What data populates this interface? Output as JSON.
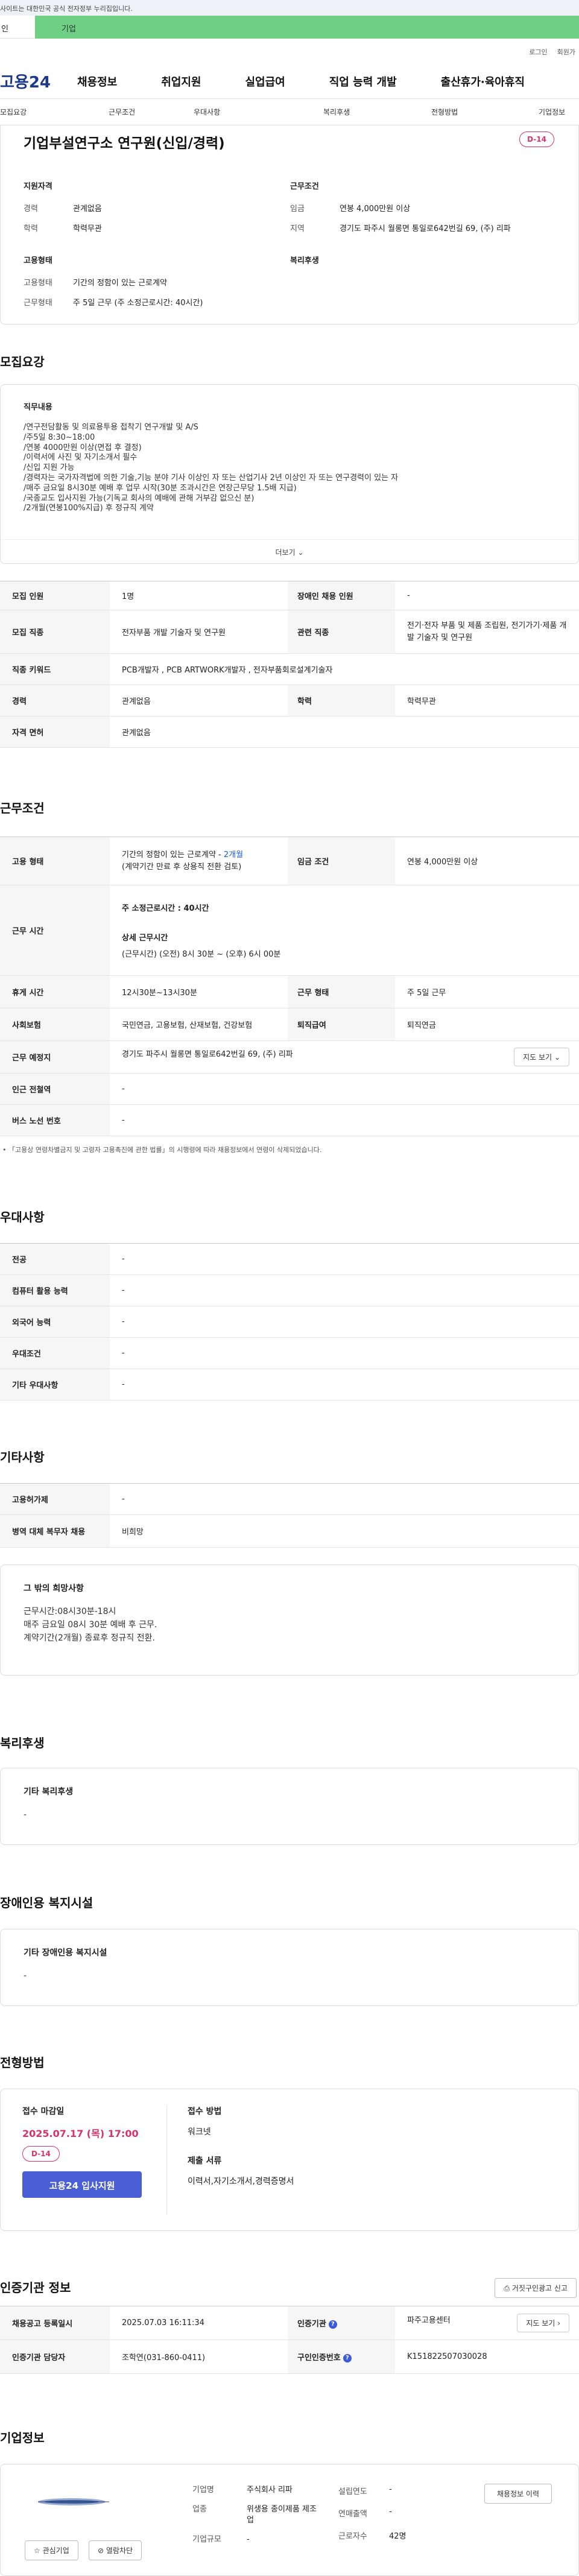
{
  "gov_banner": "사이트는 대한민국 공식 전자정부 누리집입니다.",
  "site_tabs": [
    "인",
    "기업"
  ],
  "util": {
    "login": "로그인",
    "join": "회원가"
  },
  "gnb": {
    "logo": "고용24",
    "items": [
      "채용정보",
      "취업지원",
      "실업급여",
      "직업 능력 개발",
      "출산휴가·육아휴직"
    ]
  },
  "subnav": [
    "모집요강",
    "근무조건",
    "우대사항",
    "복리후생",
    "전형방법",
    "기업정보"
  ],
  "summary": {
    "title": "기업부설연구소 연구원(신입/경력)",
    "dday": "D-14",
    "qual_heading": "지원자격",
    "career_key": "경력",
    "career_val": "관계없음",
    "edu_key": "학력",
    "edu_val": "학력무관",
    "cond_heading": "근무조건",
    "wage_key": "임금",
    "wage_val": "연봉 4,000만원 이상",
    "area_key": "지역",
    "area_val": "경기도 파주시 월롱면 통일로642번길 69, (주) 리파",
    "emp_heading": "고용형태",
    "emp_type_key": "고용형태",
    "emp_type_val": "기간의 정함이 있는 근로계약",
    "work_key": "근무형태",
    "work_val": "주 5일 근무 (주 소정근로시간: 40시간)",
    "welfare_heading": "복리후생"
  },
  "recruit": {
    "heading": "모집요강",
    "duty_heading": "직무내용",
    "duty_lines": [
      "/연구전담활동 및 의료용투용 접착기 연구개발 및 A/S",
      "/주5일 8:30~18:00",
      "/연봉 4000만원 이상(면접 후 결정)",
      "/이력서에 사진 및 자기소개서 필수",
      "/신입 지원 가능",
      "/경력자는 국가자격법에 의한 기술,기능 분야 기사 이상인 자 또는 산업기사 2년 이상인 자 또는 연구경력이 있는 자",
      "/매주 금요일 8시30분 예배 후 업무 시작(30분 조과시간은 연장근무당 1.5배 지급)",
      "/국종교도 입사지원 가능(기독교 회사의 예배에 관해 거부감 없으신 분)",
      "/2개월(연봉100%지급) 후 정규직 계약"
    ],
    "more": "더보기",
    "table": {
      "count_label": "모집 인원",
      "count_val": "1명",
      "disabled_label": "장애인 채용 인원",
      "disabled_val": "-",
      "job_label": "모집 직종",
      "job_val": "전자부품 개발 기술자 및 연구원",
      "rel_job_label": "관련 직종",
      "rel_job_val": "전기·전자 부품 및 제품 조립원, 전기가기·제품 개발 기술자 및 연구원",
      "keyword_label": "직종 키워드",
      "keyword_val": "PCB개발자 , PCB ARTWORK개발자 , 전자부품회로설계기술자",
      "career_label": "경력",
      "career_val": "관계없음",
      "edu_label": "학력",
      "edu_val": "학력무관",
      "license_label": "자격 면허",
      "license_val": "관계없음"
    }
  },
  "conditions": {
    "heading": "근무조건",
    "emp_label": "고용 형태",
    "emp_val": "기간의 정함이 있는 근로계약 -",
    "emp_months": "2개월",
    "emp_note": "(계약기간 만료 후 상용직 전환 검토)",
    "wage_label": "임금 조건",
    "wage_val": "연봉 4,000만원 이상",
    "hours_label": "근무 시간",
    "hours_total": "주 소정근로시간 : 40시간",
    "hours_detail_heading": "상세 근무시간",
    "hours_detail": "(근무시간) (오전) 8시 30분 ~ (오후) 6시 00분",
    "break_label": "휴게 시간",
    "break_val": "12시30분~13시30분",
    "form_label": "근무 형태",
    "form_val": "주 5일 근무",
    "insurance_label": "사회보험",
    "insurance_val": "국민연금, 고용보험, 산재보험, 건강보험",
    "retire_label": "퇴직급여",
    "retire_val": "퇴직연금",
    "place_label": "근무 예정지",
    "place_val": "경기도 파주시 월롱면 통일로642번길 69, (주) 리파",
    "map_btn": "지도 보기",
    "subway_label": "인근 전철역",
    "subway_val": "-",
    "bus_label": "버스 노선 번호",
    "bus_val": "-",
    "note": "「고용상 연령차별금지 및 고령자 고용촉진에 관한 법률」의 시행령에 따라 채용정보에서 연령이 삭제되었습니다."
  },
  "preference": {
    "heading": "우대사항",
    "rows": [
      {
        "label": "전공",
        "val": "-"
      },
      {
        "label": "컴퓨터 활용 능력",
        "val": "-"
      },
      {
        "label": "외국어 능력",
        "val": "-"
      },
      {
        "label": "우대조건",
        "val": "-"
      },
      {
        "label": "기타 우대사항",
        "val": "-"
      }
    ]
  },
  "etc": {
    "heading": "기타사항",
    "permit_label": "고용허가제",
    "permit_val": "-",
    "military_label": "병역 대체 복무자 채용",
    "military_val": "비희망",
    "other_heading": "그 밖의 희망사항",
    "other_lines": [
      "근무시간:08시30분-18시",
      "매주 금요일 08시 30분 예배 후 근무.",
      "계약기간(2개월) 종료후 정규직 전환."
    ]
  },
  "welfare": {
    "heading": "복리후생",
    "sub": "기타 복리후생",
    "val": "-"
  },
  "disabled_fac": {
    "heading": "장애인용 복지시설",
    "sub": "기타 장애인용 복지시설",
    "val": "-"
  },
  "selection": {
    "heading": "전형방법",
    "deadline_label": "접수 마감일",
    "deadline": "2025.07.17 (목) 17:00",
    "dday": "D-14",
    "apply_btn": "고용24 입사지원",
    "method_label": "접수 방법",
    "method_val": "워크넷",
    "docs_label": "제출 서류",
    "docs_val": "이력서,자기소개서,경력증명서"
  },
  "agency": {
    "heading": "인증기관 정보",
    "report_btn": "거짓구인광고 신고",
    "reg_label": "채용공고 등록일시",
    "reg_val": "2025.07.03 16:11:34",
    "agency_label": "인증기관",
    "agency_val": "파주고용센터",
    "map_btn": "지도 보기",
    "manager_label": "인증기관 담당자",
    "manager_val": "조학연(031-860-0411)",
    "no_label": "구인인증번호",
    "no_val": "K151822507030028"
  },
  "company": {
    "heading": "기업정보",
    "fav_btn": "관심기업",
    "block_btn": "열람차단",
    "name_label": "기업명",
    "name_val": "주식회사 리파",
    "industry_label": "업종",
    "industry_val": "위생용 종이제품 제조업",
    "size_label": "기업규모",
    "size_val": "-",
    "founded_label": "설립연도",
    "founded_val": "-",
    "sales_label": "연매출액",
    "sales_val": "-",
    "staff_label": "근로자수",
    "staff_val": "42명",
    "jobs_btn": "채용정보 이력"
  }
}
